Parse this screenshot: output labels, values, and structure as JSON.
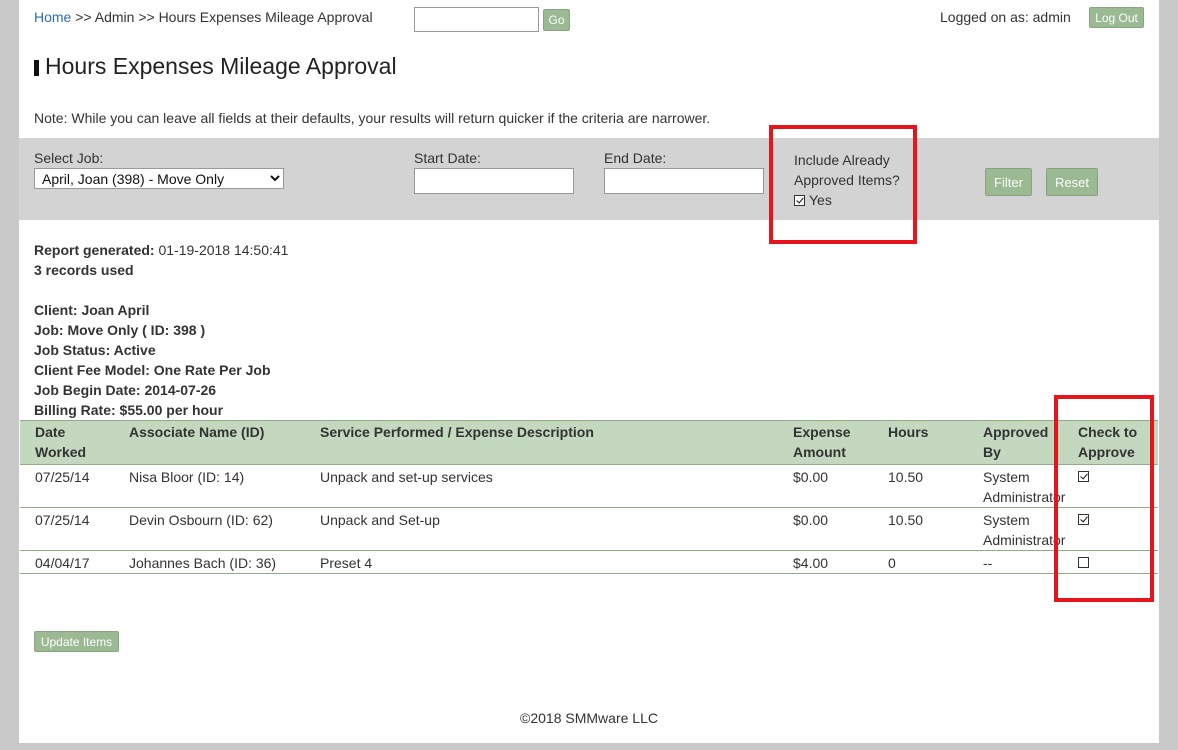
{
  "breadcrumb": {
    "home": "Home",
    "sep1": ">>",
    "admin": "Admin",
    "sep2": ">>",
    "current": "Hours Expenses Mileage Approval"
  },
  "header": {
    "search_value": "",
    "go_label": "Go",
    "logged_on": "Logged on as: admin",
    "logout_label": "Log Out"
  },
  "page_title": "Hours Expenses Mileage Approval",
  "note": "Note: While you can leave all fields at their defaults, your results will return quicker if the criteria are narrower.",
  "filters": {
    "job_label": "Select Job:",
    "job_selected": "April, Joan (398) - Move Only",
    "start_label": "Start Date:",
    "start_value": "",
    "end_label": "End Date:",
    "end_value": "",
    "include_line1": "Include Already",
    "include_line2": "Approved Items?",
    "include_yes": "Yes",
    "include_checked": true,
    "filter_label": "Filter",
    "reset_label": "Reset"
  },
  "report": {
    "generated_label": "Report generated:",
    "generated_value": "01-19-2018 14:50:41",
    "records": "3 records used",
    "client": "Client: Joan April",
    "job": "Job: Move Only ( ID: 398 )",
    "status": "Job Status: Active",
    "fee_model": "Client Fee Model: One Rate Per Job",
    "begin_date": "Job Begin Date: 2014-07-26",
    "billing_rate": "Billing Rate: $55.00 per hour"
  },
  "table": {
    "headers": {
      "date_1": "Date",
      "date_2": "Worked",
      "associate": "Associate Name (ID)",
      "service": "Service Performed / Expense Description",
      "expense_1": "Expense",
      "expense_2": "Amount",
      "hours": "Hours",
      "approved_1": "Approved",
      "approved_2": "By",
      "check_1": "Check to",
      "check_2": "Approve"
    },
    "rows": [
      {
        "date": "07/25/14",
        "associate": "Nisa Bloor (ID: 14)",
        "service": "Unpack and set-up services",
        "amount": "$0.00",
        "hours": "10.50",
        "approved_1": "System",
        "approved_2": "Administrator",
        "checked": true
      },
      {
        "date": "07/25/14",
        "associate": "Devin Osbourn (ID: 62)",
        "service": "Unpack and Set-up",
        "amount": "$0.00",
        "hours": "10.50",
        "approved_1": "System",
        "approved_2": "Administrator",
        "checked": true
      },
      {
        "date": "04/04/17",
        "associate": "Johannes Bach (ID: 36)",
        "service": "Preset 4",
        "amount": "$4.00",
        "hours": "0",
        "approved_1": "--",
        "approved_2": "",
        "checked": false
      }
    ]
  },
  "update_label": "Update Items",
  "footer": "©2018 SMMware LLC",
  "colors": {
    "accent_button": "#9bb993",
    "table_header": "#c3d8bf",
    "highlight_box": "#e8141b",
    "link": "#2a6fb5"
  }
}
